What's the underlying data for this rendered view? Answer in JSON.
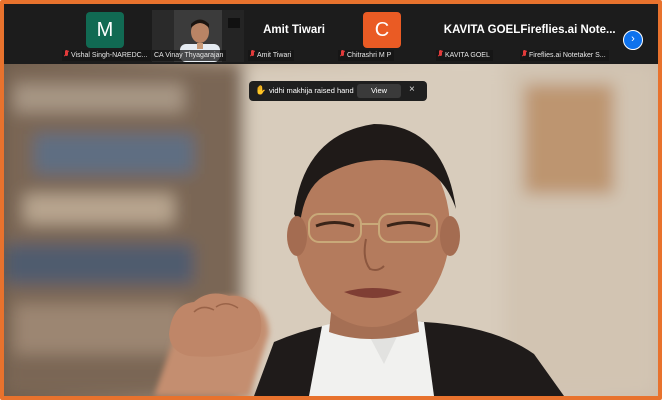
{
  "participants": [
    {
      "avatar_letter": "M",
      "avatar_color": "#116a53",
      "caption": "Vishal Singh-NAREDC..."
    },
    {
      "caption": "CA Vinay Thyagarajan"
    },
    {
      "display_name": "Amit Tiwari",
      "caption": "Amit Tiwari"
    },
    {
      "avatar_letter": "C",
      "avatar_color": "#ea5b24",
      "caption": "Chitrashri M P"
    },
    {
      "display_name": "KAVITA GOEL",
      "caption": "KAVITA GOEL"
    },
    {
      "display_name": "Fireflies.ai Note...",
      "caption": "Fireflies.ai Notetaker S..."
    }
  ],
  "notification": {
    "icon": "raised-hand-icon",
    "text": "vidhi makhija raised hand",
    "view_label": "View",
    "close_label": "×"
  },
  "controls": {
    "next_page_icon": "chevron-right-icon"
  },
  "colors": {
    "frame_border": "#e8722d",
    "accent_blue": "#0e72ed",
    "muted_red": "#e23b3b"
  }
}
